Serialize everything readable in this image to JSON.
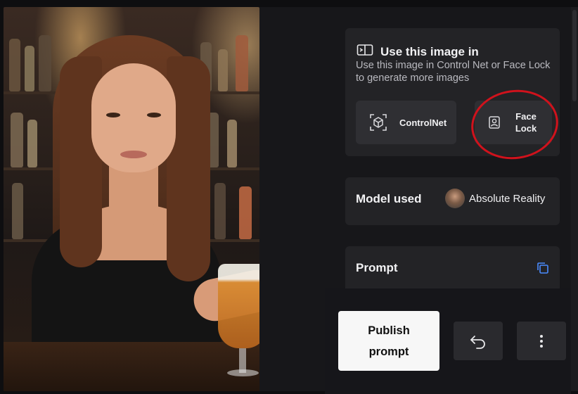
{
  "use_image": {
    "title": "Use this image in",
    "description": "Use this image in Control Net or Face Lock to generate more images",
    "options": [
      {
        "label": "ControlNet",
        "icon": "cube-icon"
      },
      {
        "label": "Face Lock",
        "icon": "portrait-icon"
      }
    ]
  },
  "model": {
    "label": "Model used",
    "value": "Absolute Reality"
  },
  "prompt": {
    "label": "Prompt"
  },
  "actions": {
    "publish_label": "Publish prompt",
    "undo_icon": "undo-icon",
    "more_icon": "more-vertical-icon"
  },
  "colors": {
    "panel_bg": "#17171a",
    "card_bg": "#232326",
    "accent_blue": "#4a8cff",
    "annotation_red": "#d0121c",
    "publish_bg": "#f7f7f7"
  }
}
